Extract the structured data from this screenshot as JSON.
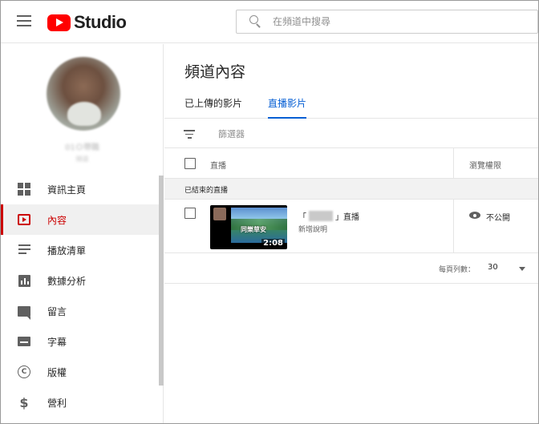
{
  "header": {
    "logo_text": "Studio",
    "search_placeholder": "在頻道中搜尋"
  },
  "sidebar": {
    "channel_name": "01Ｏ帶職",
    "channel_sub": "頻道",
    "items": [
      {
        "label": "資訊主頁",
        "icon": "dashboard-icon"
      },
      {
        "label": "內容",
        "icon": "content-icon",
        "active": true
      },
      {
        "label": "播放清單",
        "icon": "playlist-icon"
      },
      {
        "label": "數據分析",
        "icon": "analytics-icon"
      },
      {
        "label": "留言",
        "icon": "comment-icon"
      },
      {
        "label": "字幕",
        "icon": "subtitles-icon"
      },
      {
        "label": "版權",
        "icon": "copyright-icon"
      },
      {
        "label": "營利",
        "icon": "monetization-icon"
      }
    ]
  },
  "main": {
    "title": "頻道內容",
    "tabs": [
      {
        "label": "已上傳的影片"
      },
      {
        "label": "直播影片",
        "active": true
      }
    ],
    "filter_label": "篩選器",
    "columns": {
      "live": "直播",
      "visibility": "瀏覽權限"
    },
    "group_label": "已結束的直播",
    "videos": [
      {
        "title_prefix": "「",
        "title_suffix": "」直播",
        "description": "新增說明",
        "thumbnail_text": "同樂草安",
        "duration": "2:08",
        "visibility": "不公開"
      }
    ],
    "pagination": {
      "rows_per_page_label": "每頁列數：",
      "rows_per_page_value": "30"
    }
  },
  "colors": {
    "brand_red": "#ff0000",
    "active_red": "#cc0000",
    "tab_blue": "#065fd4"
  }
}
